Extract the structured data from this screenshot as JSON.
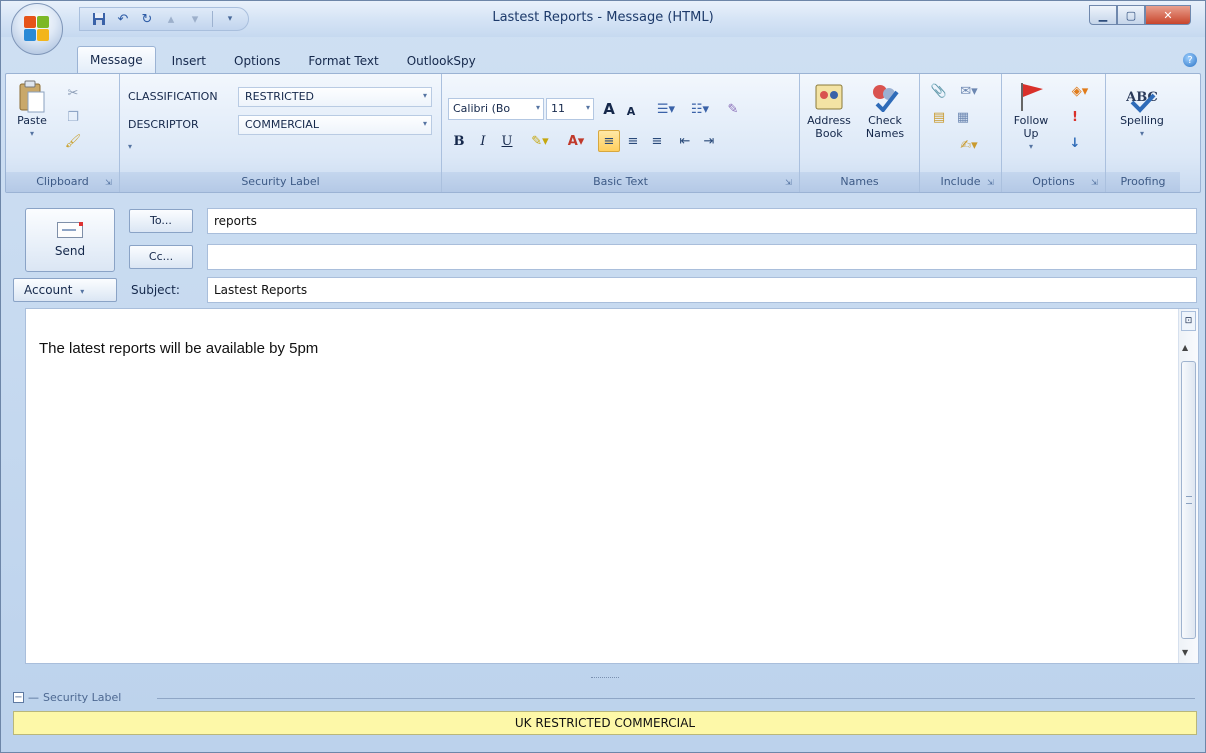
{
  "window": {
    "title": "Lastest Reports - Message (HTML)",
    "accent": "#c6d9f0"
  },
  "tabs": [
    {
      "label": "Message",
      "active": true
    },
    {
      "label": "Insert"
    },
    {
      "label": "Options"
    },
    {
      "label": "Format Text"
    },
    {
      "label": "OutlookSpy"
    }
  ],
  "ribbon": {
    "clipboard": {
      "paste_label": "Paste",
      "group_label": "Clipboard"
    },
    "security_label": {
      "classification_label": "CLASSIFICATION",
      "classification_value": "RESTRICTED",
      "descriptor_label": "DESCRIPTOR",
      "descriptor_value": "COMMERCIAL",
      "group_label": "Security Label"
    },
    "basic_text": {
      "font_name": "Calibri (Bo",
      "font_size": "11",
      "bold": "B",
      "italic": "I",
      "underline": "U",
      "grow_font": "A",
      "shrink_font": "A",
      "group_label": "Basic Text"
    },
    "names": {
      "address_book": "Address Book",
      "check_names": "Check Names",
      "group_label": "Names"
    },
    "include": {
      "group_label": "Include"
    },
    "options": {
      "follow_up": "Follow Up",
      "group_label": "Options"
    },
    "proofing": {
      "spelling_icon_text": "ABC",
      "spelling": "Spelling",
      "group_label": "Proofing"
    }
  },
  "compose": {
    "send_label": "Send",
    "to_label": "To...",
    "to_value": "reports",
    "cc_label": "Cc...",
    "cc_value": "",
    "account_label": "Account",
    "subject_label": "Subject:",
    "subject_value": "Lastest Reports",
    "body": "The latest reports will be available by 5pm"
  },
  "security_footer": {
    "header": "Security Label",
    "banner": "UK RESTRICTED COMMERCIAL",
    "banner_color": "#fdf8a8"
  }
}
